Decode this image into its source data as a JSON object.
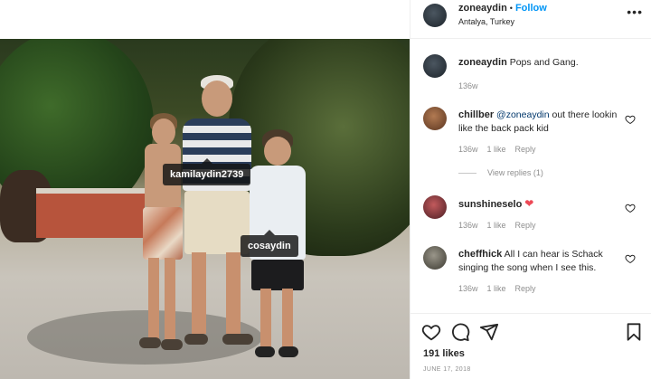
{
  "post": {
    "username": "zoneaydin",
    "follow_label": "Follow",
    "location": "Antalya, Turkey",
    "more_label": "•••",
    "caption_username": "zoneaydin",
    "caption_text": "Pops and Gang.",
    "caption_age": "136w"
  },
  "photo": {
    "tags": [
      {
        "label": "kamilaydin2739"
      },
      {
        "label": "cosaydin"
      }
    ]
  },
  "comments": [
    {
      "username": "chillber",
      "mention": "@zoneaydin",
      "text": " out there lookin like the back pack kid",
      "age": "136w",
      "likes": "1 like",
      "reply": "Reply",
      "view_replies": "View replies (1)",
      "avatar_color": "#8a5a3c"
    },
    {
      "username": "sunshineselo",
      "text": "",
      "emoji": "❤",
      "age": "136w",
      "likes": "1 like",
      "reply": "Reply",
      "avatar_color": "#7c3b3e"
    },
    {
      "username": "cheffhick",
      "text": " All I can hear is Schack singing the song when I see this.",
      "age": "136w",
      "likes": "1 like",
      "reply": "Reply",
      "avatar_color": "#6e6b5e"
    }
  ],
  "actions": {
    "likes_count": "191 likes",
    "date": "JUNE 17, 2018",
    "icons": [
      "heart-icon",
      "comment-icon",
      "share-icon",
      "bookmark-icon"
    ]
  },
  "colors": {
    "follow": "#0095f6",
    "mention": "#00376b",
    "heart": "#ed4956",
    "muted": "#8e8e8e"
  }
}
